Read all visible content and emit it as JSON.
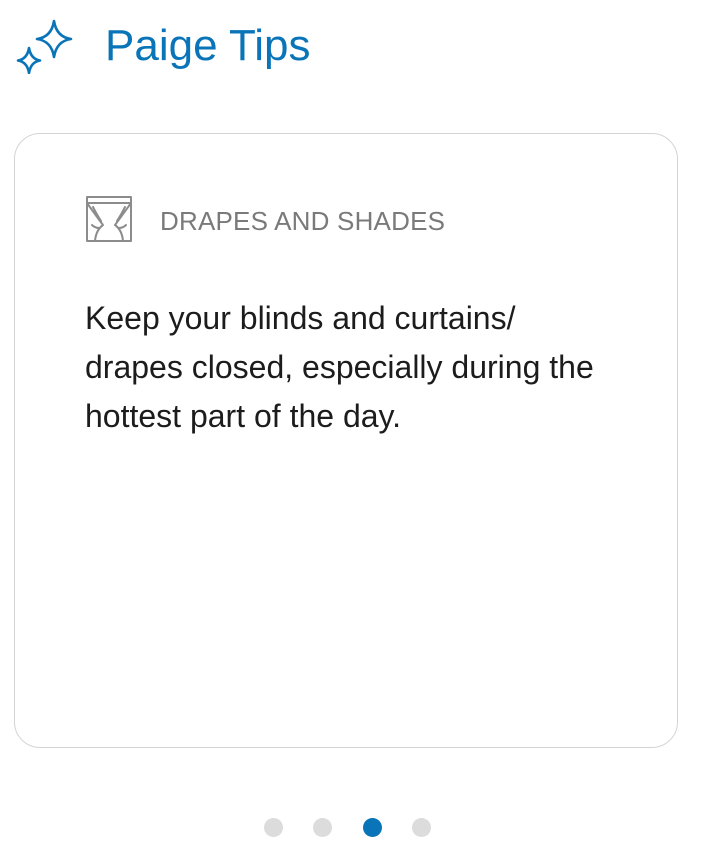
{
  "header": {
    "title": "Paige Tips",
    "icon": "sparkle-icon"
  },
  "card": {
    "icon": "curtains-icon",
    "category": "DRAPES AND SHADES",
    "body": "Keep your blinds and curtains/ drapes closed, especially during the hottest part of the day."
  },
  "pager": {
    "total": 4,
    "active_index": 2
  },
  "colors": {
    "accent": "#0a74b8",
    "inactive_dot": "#dcdcdc",
    "card_border": "#d4d4d4",
    "category_text": "#7a7a7a",
    "body_text": "#1c1c1c"
  }
}
